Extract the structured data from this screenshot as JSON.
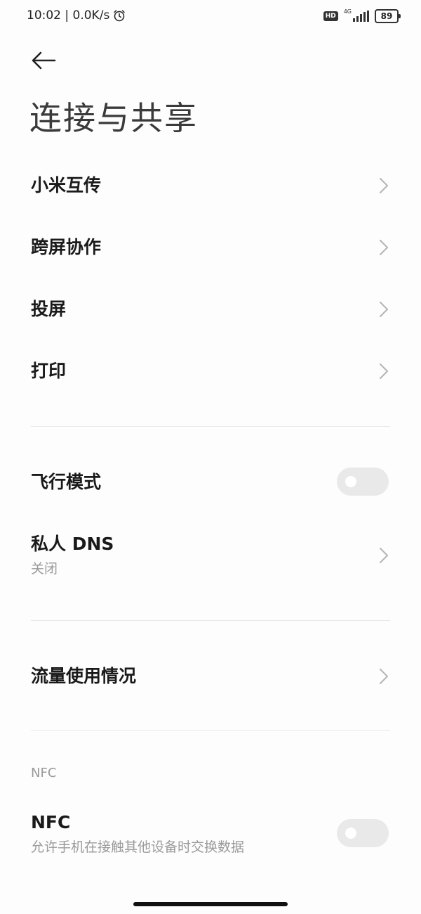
{
  "status_bar": {
    "time_speed": "10:02 | 0.0K/s",
    "hd_badge": "HD",
    "network_type": "4G",
    "battery_level": "89"
  },
  "page": {
    "title": "连接与共享"
  },
  "rows": {
    "mi_share": {
      "label": "小米互传"
    },
    "cross_screen": {
      "label": "跨屏协作"
    },
    "cast": {
      "label": "投屏"
    },
    "print": {
      "label": "打印"
    },
    "airplane_mode": {
      "label": "飞行模式",
      "enabled": false
    },
    "private_dns": {
      "label": "私人 DNS",
      "value": "关闭"
    },
    "data_usage": {
      "label": "流量使用情况"
    }
  },
  "nfc_section": {
    "header": "NFC",
    "label": "NFC",
    "description": "允许手机在接触其他设备时交换数据",
    "enabled": false
  }
}
